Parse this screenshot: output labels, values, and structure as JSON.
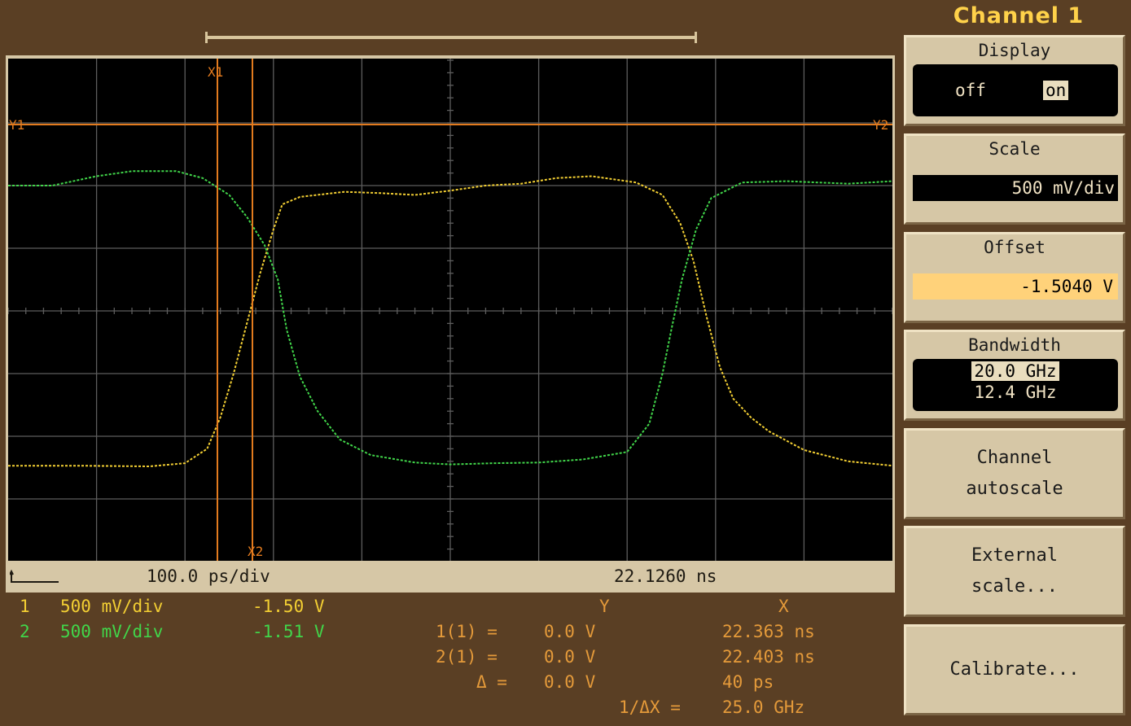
{
  "title": "Channel 1",
  "cursors": {
    "x1": "X1",
    "x2": "X2",
    "y1": "Y1",
    "y2": "Y2"
  },
  "status": {
    "timebase": "100.0 ps/div",
    "position": "22.1260 ns"
  },
  "channels": [
    {
      "num": "1",
      "scale": "500 mV/div",
      "offset": "-1.50 V"
    },
    {
      "num": "2",
      "scale": "500 mV/div",
      "offset": "-1.51 V"
    }
  ],
  "measure": {
    "y_header": "Y",
    "x_header": "X",
    "row1_label": "1(1) =",
    "row1_y": "0.0 V",
    "row1_x": "22.363 ns",
    "row2_label": "2(1) =",
    "row2_y": "0.0 V",
    "row2_x": "22.403 ns",
    "delta_label": "Δ =",
    "delta_y": "0.0 V",
    "delta_x": "40 ps",
    "inv_label": "1/ΔX =",
    "inv_x": "25.0 GHz"
  },
  "softkeys": {
    "display": {
      "label": "Display",
      "off": "off",
      "on": "on"
    },
    "scale": {
      "label": "Scale",
      "value": "500 mV/div"
    },
    "offset": {
      "label": "Offset",
      "value": "-1.5040 V"
    },
    "bandwidth": {
      "label": "Bandwidth",
      "opt1": "20.0 GHz",
      "opt2": "12.4 GHz"
    },
    "autoscale": {
      "line1": "Channel",
      "line2": "autoscale"
    },
    "external": {
      "line1": "External",
      "line2": "scale..."
    },
    "calibrate": {
      "label": "Calibrate..."
    }
  },
  "colors": {
    "ch1": "#f3cf33",
    "ch2": "#41d64a",
    "cursor": "#e37b1e",
    "grid": "#5d5d5d"
  },
  "traces": {
    "ch1": [
      [
        -5,
        -2.47
      ],
      [
        -4.2,
        -2.47
      ],
      [
        -3.4,
        -2.48
      ],
      [
        -3.0,
        -2.43
      ],
      [
        -2.75,
        -2.2
      ],
      [
        -2.6,
        -1.7
      ],
      [
        -2.45,
        -1.0
      ],
      [
        -2.3,
        -0.2
      ],
      [
        -2.15,
        0.6
      ],
      [
        -2.0,
        1.3
      ],
      [
        -1.9,
        1.7
      ],
      [
        -1.7,
        1.82
      ],
      [
        -1.2,
        1.9
      ],
      [
        -0.8,
        1.88
      ],
      [
        -0.4,
        1.85
      ],
      [
        0,
        1.92
      ],
      [
        0.4,
        2.0
      ],
      [
        0.8,
        2.03
      ],
      [
        1.2,
        2.12
      ],
      [
        1.6,
        2.15
      ],
      [
        2.1,
        2.05
      ],
      [
        2.4,
        1.85
      ],
      [
        2.6,
        1.4
      ],
      [
        2.75,
        0.8
      ],
      [
        2.9,
        -0.1
      ],
      [
        3.05,
        -0.9
      ],
      [
        3.2,
        -1.4
      ],
      [
        3.4,
        -1.7
      ],
      [
        3.6,
        -1.92
      ],
      [
        4.0,
        -2.22
      ],
      [
        4.5,
        -2.4
      ],
      [
        5,
        -2.47
      ]
    ],
    "ch2": [
      [
        -5,
        2.0
      ],
      [
        -4.5,
        2.0
      ],
      [
        -4.0,
        2.15
      ],
      [
        -3.6,
        2.23
      ],
      [
        -3.1,
        2.23
      ],
      [
        -2.8,
        2.12
      ],
      [
        -2.5,
        1.85
      ],
      [
        -2.3,
        1.5
      ],
      [
        -2.1,
        1.05
      ],
      [
        -1.95,
        0.5
      ],
      [
        -1.85,
        -0.3
      ],
      [
        -1.7,
        -1.05
      ],
      [
        -1.5,
        -1.6
      ],
      [
        -1.25,
        -2.05
      ],
      [
        -0.9,
        -2.3
      ],
      [
        -0.4,
        -2.42
      ],
      [
        0,
        -2.45
      ],
      [
        0.5,
        -2.43
      ],
      [
        1.0,
        -2.42
      ],
      [
        1.5,
        -2.37
      ],
      [
        2.0,
        -2.25
      ],
      [
        2.25,
        -1.8
      ],
      [
        2.4,
        -1.0
      ],
      [
        2.5,
        -0.3
      ],
      [
        2.62,
        0.5
      ],
      [
        2.78,
        1.3
      ],
      [
        2.95,
        1.8
      ],
      [
        3.3,
        2.05
      ],
      [
        3.8,
        2.07
      ],
      [
        4.5,
        2.03
      ],
      [
        5,
        2.07
      ]
    ]
  }
}
